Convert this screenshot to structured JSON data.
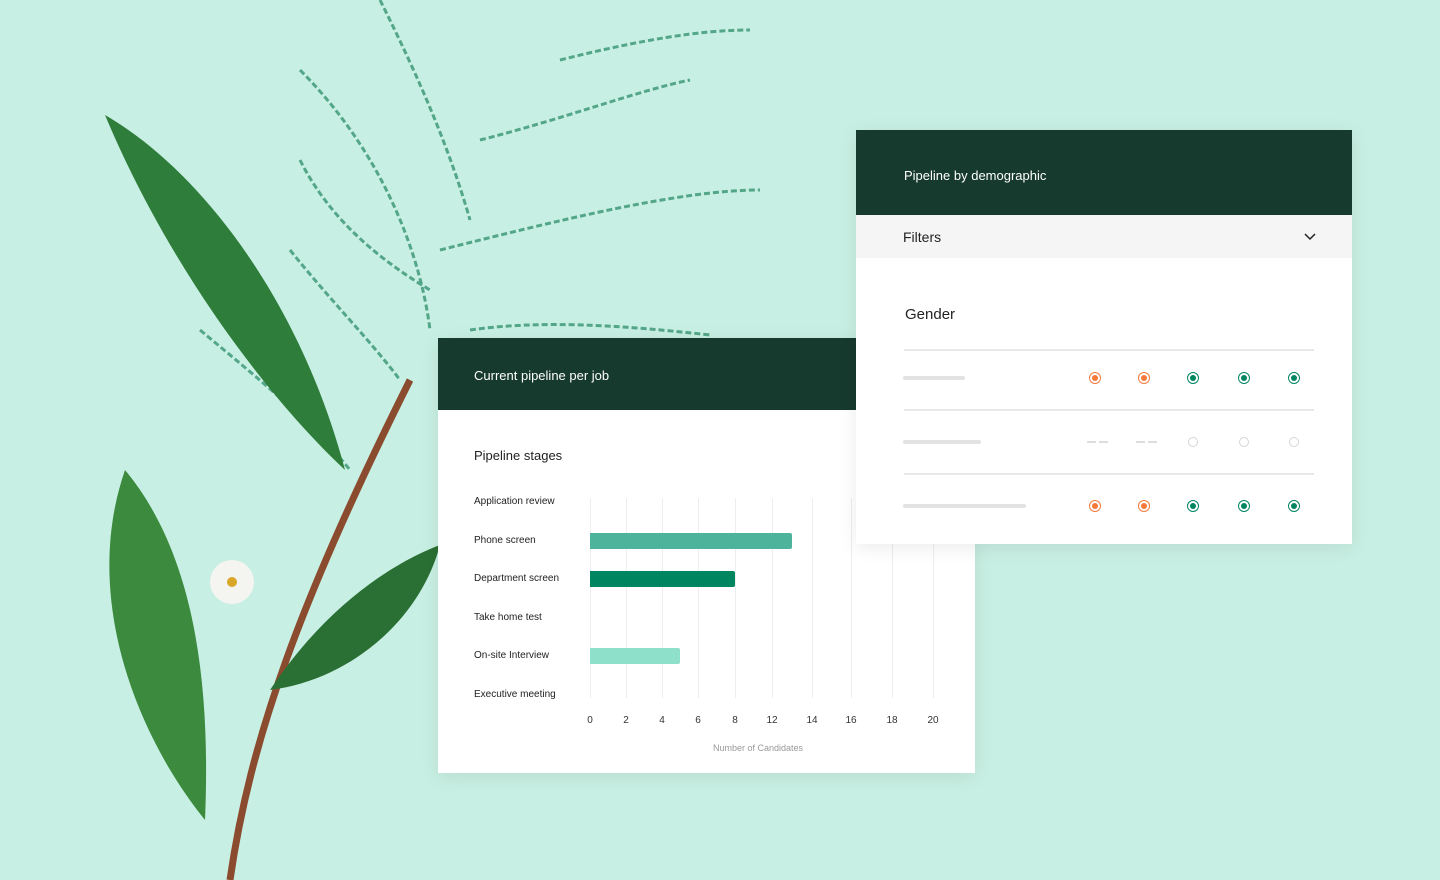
{
  "colors": {
    "background": "#c8efe3",
    "header": "#173a2e",
    "bar_phone": "#4db39a",
    "bar_department": "#008561",
    "bar_onsite": "#8ee0cb",
    "orange": "#f5793b",
    "green": "#008561"
  },
  "pipeline_card": {
    "title": "Current pipeline per job",
    "subtitle": "Pipeline stages"
  },
  "demographic_card": {
    "title": "Pipeline by demographic",
    "filters_label": "Filters",
    "filters_icon": "chevron-down-icon",
    "section": "Gender",
    "rows": [
      {
        "states": [
          "orange",
          "orange",
          "green",
          "green",
          "green"
        ]
      },
      {
        "states": [
          "dash",
          "dash",
          "empty",
          "empty",
          "empty"
        ]
      },
      {
        "states": [
          "orange",
          "orange",
          "green",
          "green",
          "green"
        ]
      }
    ]
  },
  "chart_data": {
    "type": "bar",
    "orientation": "horizontal",
    "categories": [
      "Application review",
      "Phone screen",
      "Department screen",
      "Take home test",
      "On-site Interview",
      "Executive meeting"
    ],
    "values": [
      0,
      13,
      8,
      0,
      5,
      0
    ],
    "xlabel": "Number of Candidates",
    "xticks": [
      0,
      2,
      4,
      6,
      8,
      12,
      14,
      16,
      18,
      20
    ],
    "xlim": [
      0,
      20
    ],
    "grid": true
  }
}
